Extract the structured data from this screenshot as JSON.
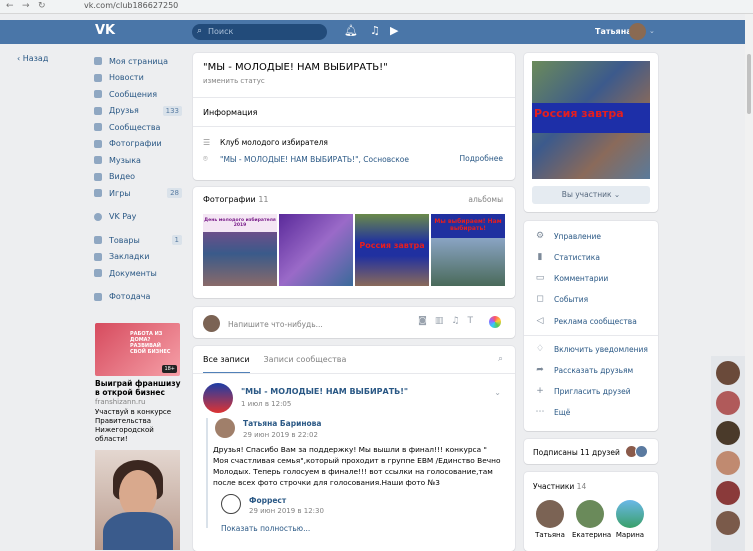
{
  "browser": {
    "url": "vk.com/club186627250"
  },
  "header": {
    "search_placeholder": "Поиск",
    "user_name": "Татьяна"
  },
  "back_label": "Назад",
  "leftnav": {
    "items": [
      {
        "label": "Моя страница",
        "badge": ""
      },
      {
        "label": "Новости",
        "badge": ""
      },
      {
        "label": "Сообщения",
        "badge": ""
      },
      {
        "label": "Друзья",
        "badge": "133"
      },
      {
        "label": "Сообщества",
        "badge": ""
      },
      {
        "label": "Фотографии",
        "badge": ""
      },
      {
        "label": "Музыка",
        "badge": ""
      },
      {
        "label": "Видео",
        "badge": ""
      },
      {
        "label": "Игры",
        "badge": "28"
      }
    ],
    "items2": [
      {
        "label": "VK Pay",
        "badge": ""
      }
    ],
    "items3": [
      {
        "label": "Товары",
        "badge": "1"
      },
      {
        "label": "Закладки",
        "badge": ""
      },
      {
        "label": "Документы",
        "badge": ""
      }
    ],
    "items4": [
      {
        "label": "Фотодача",
        "badge": ""
      }
    ]
  },
  "ads": {
    "ad1_image_text": "РАБОТА ИЗ ДОМА? РАЗВИВАЙ СВОЙ БИЗНЕС",
    "ad1_age": "18+",
    "ad1_title": "Выиграй франшизу в открой бизнес",
    "ad1_site": "franshizann.ru",
    "ad1_desc": "Участвуй в конкурсе Правительства Нижегородской области!"
  },
  "group": {
    "name": "\"МЫ - МОЛОДЫЕ! НАМ ВЫБИРАТЬ!\"",
    "status_placeholder": "изменить статус",
    "info_title": "Информация",
    "info_desc": "Клуб молодого избирателя",
    "info_location": "\"МЫ - МОЛОДЫЕ! НАМ ВЫБИРАТЬ!\", Сосновское",
    "info_more": "Подробнее"
  },
  "photos": {
    "title": "Фотографии",
    "count": "11",
    "albums_label": "альбомы",
    "thumb1_caption": "День молодого избирателя 2019",
    "thumb3_caption": "Россия завтра",
    "thumb4_caption": "Мы выбираем! Нам выбирать!"
  },
  "composer": {
    "placeholder": "Напишите что-нибудь..."
  },
  "wall": {
    "tab_all": "Все записи",
    "tab_community": "Записи сообщества",
    "post_author": "\"МЫ - МОЛОДЫЕ! НАМ ВЫБИРАТЬ!\"",
    "post_date": "1 июл в 12:05",
    "repost_author": "Татьяна Баринова",
    "repost_date": "29 июн 2019 в 22:02",
    "text": "Друзья! Спасибо Вам за поддержку! Мы вышли в финал!!! конкурса \" Моя счастливая семья\",который проходит в группе ЕВМ /Единство Вечно Молодых. Теперь голосуем в финале!!! вот ссылки на голосование,там после всех фото строчки для голосования.Наши фото №3",
    "sub_author": "Форрест",
    "sub_date": "29 июн 2019 в 12:30",
    "show_more": "Показать полностью..."
  },
  "cover": {
    "text": "Россия  завтра",
    "member_button": "Вы участник"
  },
  "manage_menu": [
    {
      "label": "Управление",
      "icon": "gear-icon"
    },
    {
      "label": "Статистика",
      "icon": "stats-icon"
    },
    {
      "label": "Комментарии",
      "icon": "comment-icon"
    },
    {
      "label": "События",
      "icon": "event-icon"
    },
    {
      "label": "Реклама сообщества",
      "icon": "megaphone-icon"
    }
  ],
  "action_menu": [
    {
      "label": "Включить уведомления",
      "icon": "bell-icon"
    },
    {
      "label": "Рассказать друзьям",
      "icon": "share-icon"
    },
    {
      "label": "Пригласить друзей",
      "icon": "invite-icon"
    },
    {
      "label": "Ещё",
      "icon": "more-icon"
    }
  ],
  "subscribers": {
    "text": "Подписаны 11 друзей"
  },
  "members": {
    "title": "Участники",
    "count": "14",
    "people": [
      "Татьяна",
      "Екатерина",
      "Марина"
    ]
  },
  "colors": {
    "header": "#4a76a8",
    "link": "#2a5885",
    "bg": "#edeef0"
  }
}
